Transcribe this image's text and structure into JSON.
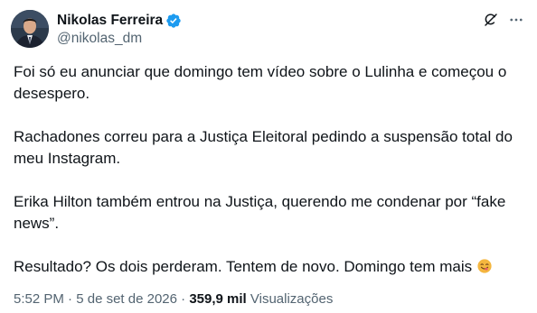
{
  "author": {
    "display_name": "Nikolas Ferreira",
    "handle": "@nikolas_dm",
    "verified": true
  },
  "icons": {
    "verified": "verified-badge-icon",
    "grok": "grok-icon",
    "more": "more-icon",
    "emoji": "yum-face-emoji",
    "accent_color": "#1d9bf0"
  },
  "post": {
    "paragraphs": [
      "Foi só eu anunciar que domingo tem vídeo sobre o Lulinha e começou o desespero.",
      "Rachadones correu para a Justiça Eleitoral pedindo a suspensão total do meu Instagram.",
      "Erika Hilton também entrou na Justiça, querendo me condenar por “fake news”.",
      "Resultado? Os dois perderam. Tentem de novo. Domingo tem mais"
    ]
  },
  "meta": {
    "time": "5:52 PM",
    "date": "5 de set de 2026",
    "separator": "·",
    "views_count": "359,9 mil",
    "views_label": "Visualizações"
  }
}
